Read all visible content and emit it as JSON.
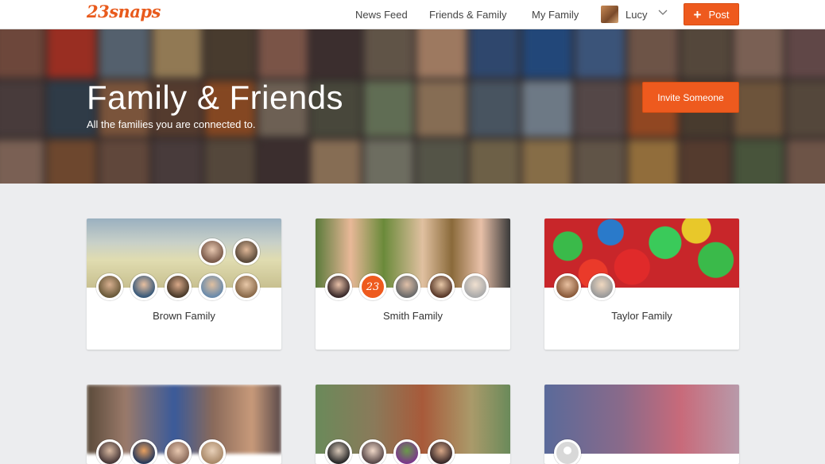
{
  "topbar": {
    "logo": "23snaps",
    "nav": [
      "News Feed",
      "Friends & Family",
      "My Family"
    ],
    "user_name": "Lucy",
    "post_label": "Post",
    "post_icon": "plus-icon"
  },
  "hero": {
    "title": "Family & Friends",
    "subtitle": "All the families you are connected to.",
    "invite_label": "Invite Someone"
  },
  "families": [
    {
      "name": "Brown Family",
      "avatars": 7
    },
    {
      "name": "Smith Family",
      "avatars": 5,
      "badge": "23"
    },
    {
      "name": "Taylor Family",
      "avatars": 2
    },
    {
      "name": "",
      "avatars": 4
    },
    {
      "name": "",
      "avatars": 4
    },
    {
      "name": "",
      "avatars": 1
    }
  ],
  "colors": {
    "accent": "#ee5a1e",
    "logo": "#e85a1c",
    "background": "#ecedef"
  }
}
